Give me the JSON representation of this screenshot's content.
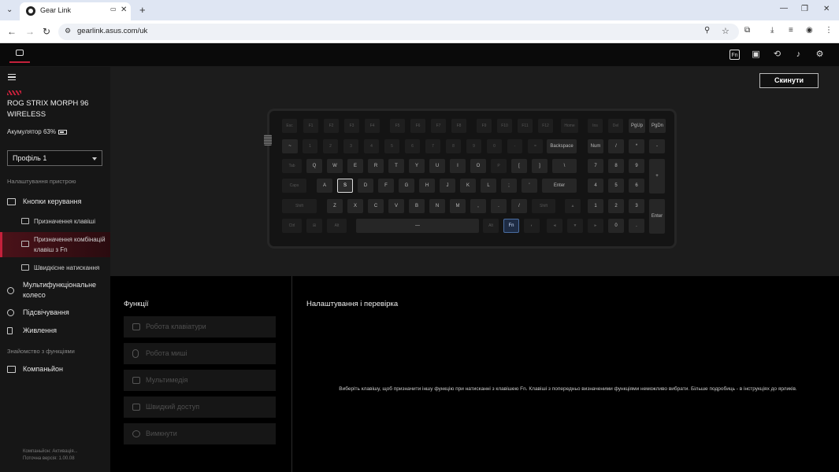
{
  "browser": {
    "tab_title": "Gear Link",
    "url": "gearlink.asus.com/uk"
  },
  "sidebar": {
    "device_name": "ROG STRIX MORPH 96 WIRELESS",
    "battery": "Акумулятор 63%",
    "profile": "Профіль 1",
    "section_device_settings": "Налаштування пристрою",
    "nav": {
      "control_buttons": "Кнопки керування",
      "key_assignment": "Призначення клавіші",
      "fn_combo": "Призначення комбінацій клавіш з Fn",
      "quick_press": "Швидкісне натискання",
      "multifunction_wheel": "Мультифункціональне колесо",
      "lighting": "Підсвічування",
      "power": "Живлення"
    },
    "section_features": "Знайомство з функціями",
    "companion": "Компаньйон",
    "footer_line1": "Компаньйон:  Активація...",
    "footer_line2": "Поточна версія: 1.00.08"
  },
  "main": {
    "reset_button": "Скинути"
  },
  "keyboard": {
    "row1": [
      "Esc",
      "F1",
      "F2",
      "F3",
      "F4",
      "F5",
      "F6",
      "F7",
      "F8",
      "F9",
      "F10",
      "F11",
      "F12",
      "Home",
      "Ins",
      "Del",
      "PgUp",
      "PgDn"
    ],
    "row2": [
      "~",
      "1",
      "2",
      "3",
      "4",
      "5",
      "6",
      "7",
      "8",
      "9",
      "0",
      "-",
      "=",
      "Backspace",
      "Num",
      "/",
      "*",
      "-"
    ],
    "row3": [
      "Tab",
      "Q",
      "W",
      "E",
      "R",
      "T",
      "Y",
      "U",
      "I",
      "O",
      "P",
      "[",
      "]",
      "\\",
      "7",
      "8",
      "9",
      "+"
    ],
    "row4": [
      "Caps",
      "A",
      "S",
      "D",
      "F",
      "G",
      "H",
      "J",
      "K",
      "L",
      ";",
      "'",
      "Enter",
      "4",
      "5",
      "6"
    ],
    "row5": [
      "Shift",
      "Z",
      "X",
      "C",
      "V",
      "B",
      "N",
      "M",
      ",",
      ".",
      "/",
      "Shift",
      "▲",
      "1",
      "2",
      "3",
      "Enter"
    ],
    "row6": [
      "Ctrl",
      "⊞",
      "Alt",
      "—",
      "Alt",
      "Fn",
      "◐",
      "◄",
      "▼",
      "►",
      "0",
      "."
    ]
  },
  "functions": {
    "title": "Функції",
    "items": [
      "Робота клавіатури",
      "Робота миші",
      "Мультимедія",
      "Швидкий доступ",
      "Вимкнути"
    ]
  },
  "settings": {
    "title": "Налаштування і перевірка",
    "hint": "Виберіть клавішу, щоб призначити іншу функцію при натисканні з клавішею Fn. Клавіші з попередньо визначеними функціями неможливо вибрати. Більше подробиць - в інструкціях до ярликів."
  },
  "colors": {
    "accent": "#c4213b",
    "fn_key_highlight": "#4a6da0"
  }
}
